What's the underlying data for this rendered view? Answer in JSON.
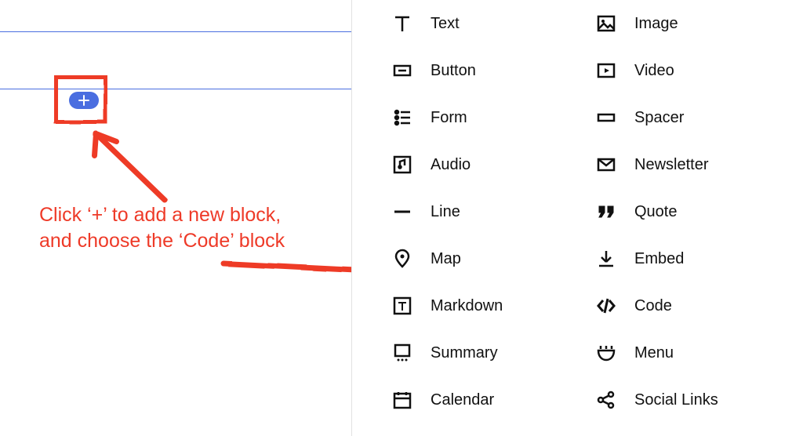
{
  "instruction_text": "Click ‘+’ to add a new block, and choose the ‘Code’ block",
  "colors": {
    "annotation": "#ee3a28",
    "accent": "#4a6ee0"
  },
  "block_menu": {
    "left_column": [
      {
        "label": "Text",
        "icon": "text-icon"
      },
      {
        "label": "Button",
        "icon": "button-icon"
      },
      {
        "label": "Form",
        "icon": "form-icon"
      },
      {
        "label": "Audio",
        "icon": "audio-icon"
      },
      {
        "label": "Line",
        "icon": "line-icon"
      },
      {
        "label": "Map",
        "icon": "map-icon"
      },
      {
        "label": "Markdown",
        "icon": "markdown-icon"
      },
      {
        "label": "Summary",
        "icon": "summary-icon"
      },
      {
        "label": "Calendar",
        "icon": "calendar-icon"
      }
    ],
    "right_column": [
      {
        "label": "Image",
        "icon": "image-icon"
      },
      {
        "label": "Video",
        "icon": "video-icon"
      },
      {
        "label": "Spacer",
        "icon": "spacer-icon"
      },
      {
        "label": "Newsletter",
        "icon": "newsletter-icon"
      },
      {
        "label": "Quote",
        "icon": "quote-icon"
      },
      {
        "label": "Embed",
        "icon": "embed-icon"
      },
      {
        "label": "Code",
        "icon": "code-icon"
      },
      {
        "label": "Menu",
        "icon": "menu-icon"
      },
      {
        "label": "Social Links",
        "icon": "social-links-icon"
      }
    ]
  }
}
